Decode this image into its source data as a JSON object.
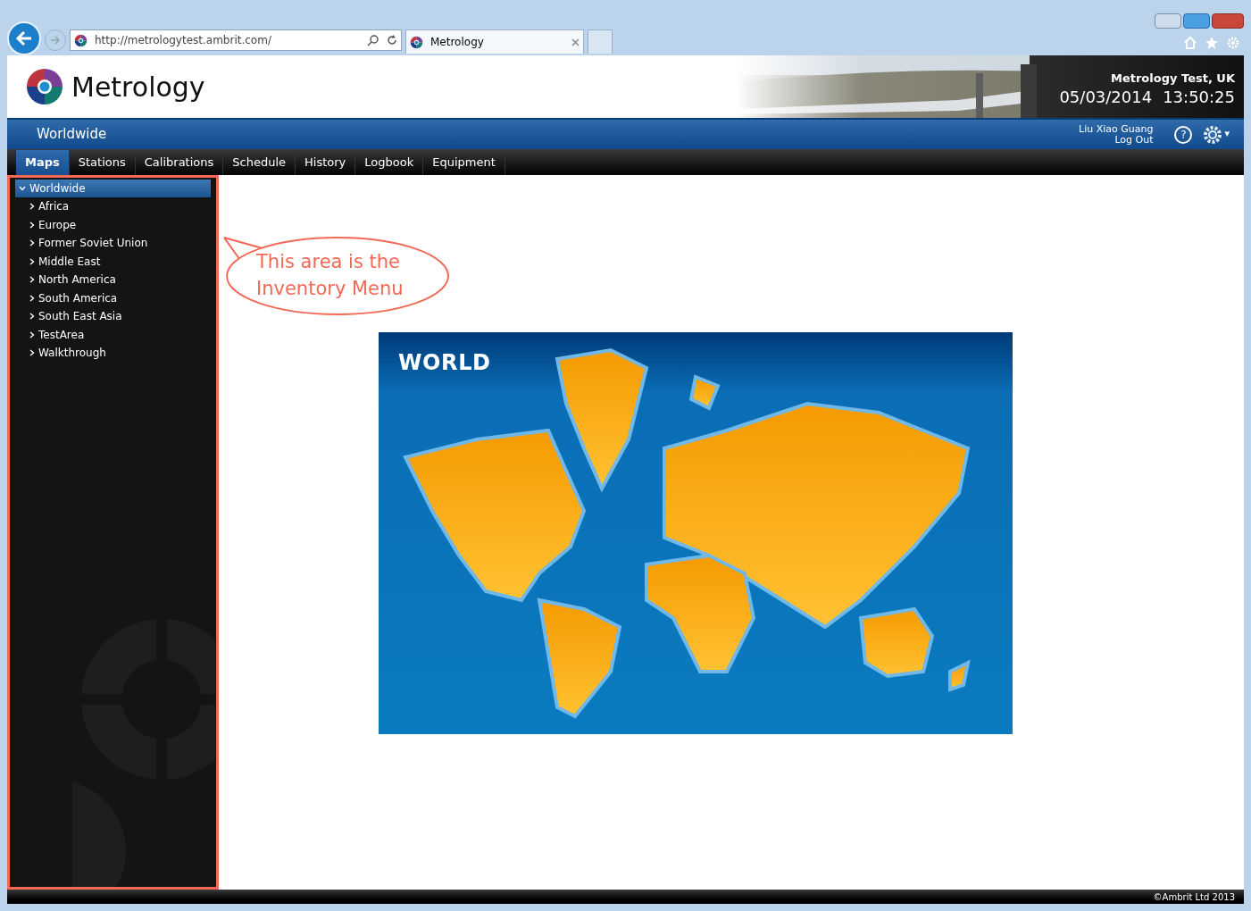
{
  "browser": {
    "address": "http://metrologytest.ambrit.com/",
    "tab_title": "Metrology"
  },
  "header": {
    "logo_text": "Metrology",
    "site": "Metrology Test, UK",
    "date": "05/03/2014",
    "time": "13:50:25"
  },
  "title_bar": {
    "title": "Worldwide",
    "user": "Liu Xiao Guang",
    "logout": "Log Out",
    "help": "?",
    "gear_caret": "▾"
  },
  "tabs": [
    {
      "label": "Maps",
      "selected": true
    },
    {
      "label": "Stations",
      "selected": false
    },
    {
      "label": "Calibrations",
      "selected": false
    },
    {
      "label": "Schedule",
      "selected": false
    },
    {
      "label": "History",
      "selected": false
    },
    {
      "label": "Logbook",
      "selected": false
    },
    {
      "label": "Equipment",
      "selected": false
    }
  ],
  "tree": [
    {
      "label": "Worldwide",
      "expanded": true,
      "selected": true,
      "children": [
        {
          "label": "Africa",
          "expanded": false,
          "selected": false
        },
        {
          "label": "Europe",
          "expanded": false,
          "selected": false
        },
        {
          "label": "Former Soviet Union",
          "expanded": false,
          "selected": false
        },
        {
          "label": "Middle East",
          "expanded": false,
          "selected": false
        },
        {
          "label": "North America",
          "expanded": false,
          "selected": false
        },
        {
          "label": "South America",
          "expanded": false,
          "selected": false
        },
        {
          "label": "South East Asia",
          "expanded": false,
          "selected": false
        },
        {
          "label": "TestArea",
          "expanded": false,
          "selected": false
        },
        {
          "label": "Walkthrough",
          "expanded": false,
          "selected": false
        }
      ]
    }
  ],
  "callout": "This area is the Inventory Menu",
  "map": {
    "title": "WORLD"
  },
  "footer": "©Ambrit Ltd 2013"
}
